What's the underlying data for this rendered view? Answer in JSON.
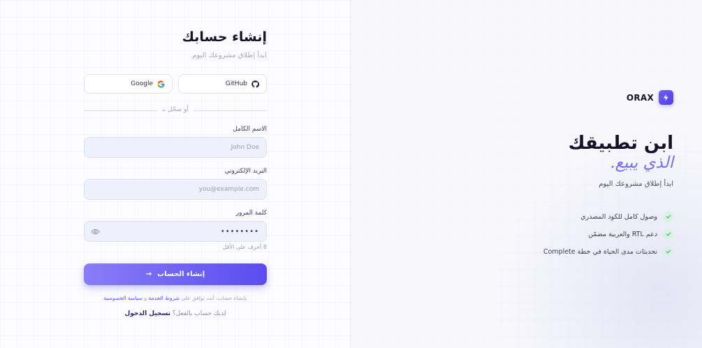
{
  "form": {
    "title": "إنشاء حسابك",
    "subtitle": "ابدأ إطلاق مشروعك اليوم",
    "social": {
      "github_label": "GitHub",
      "google_label": "Google"
    },
    "divider_text": "أو سجّل بـ",
    "fields": {
      "name": {
        "label": "الاسم الكامل",
        "placeholder": "John Doe"
      },
      "email": {
        "label": "البريد الإلكتروني",
        "placeholder": "you@example.com"
      },
      "password": {
        "label": "كلمة المرور",
        "value": "••••••••",
        "hint": "8 أحرف على الأقل"
      }
    },
    "submit_label": "إنشاء الحساب",
    "terms": {
      "prefix": "بإنشاء حساب، أنت توافق على",
      "terms_link": "شروط الخدمة",
      "and": "و",
      "privacy_link": "سياسة الخصوصية"
    },
    "login": {
      "prompt": "لديك حساب بالفعل؟",
      "link": "تسجيل الدخول"
    }
  },
  "hero": {
    "brand_name": "ORAX",
    "title": "ابن تطبيقك",
    "accent": "الذي يبيع.",
    "subtitle": "ابدأ إطلاق مشروعك اليوم",
    "features": [
      "وصول كامل للكود المصدري",
      "دعم RTL والعربية مضمّن",
      "تحديثات مدى الحياة في خطة Complete"
    ]
  },
  "colors": {
    "accent": "#5a4cf0",
    "accent_light": "#8a7df7",
    "check_bg": "#d8f1e2",
    "check_fg": "#2fae68"
  }
}
